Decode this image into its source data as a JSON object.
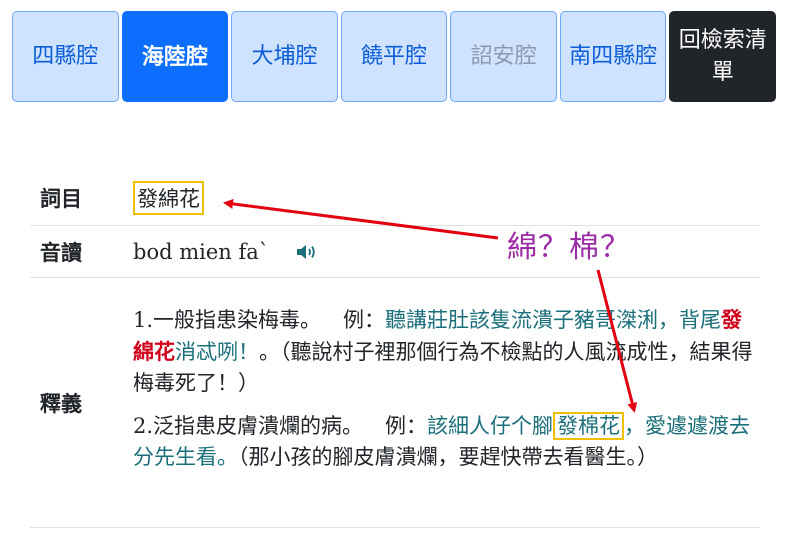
{
  "tabs": [
    {
      "label": "四縣腔",
      "state": "normal"
    },
    {
      "label": "海陸腔",
      "state": "active"
    },
    {
      "label": "大埔腔",
      "state": "normal"
    },
    {
      "label": "饒平腔",
      "state": "normal"
    },
    {
      "label": "詔安腔",
      "state": "disabled"
    },
    {
      "label": "南四縣腔",
      "state": "normal"
    },
    {
      "label": "回檢索清單",
      "state": "dark"
    }
  ],
  "entry": {
    "term_label": "詞目",
    "term": "發綿花",
    "pron_label": "音讀",
    "pron": "bod mien fa`",
    "pron_icon": "speaker-icon",
    "def_label": "釋義",
    "definitions": [
      {
        "num": "1.",
        "text": "一般指患染梅毒。",
        "ex_label": "例：",
        "ex_a": "聽講莊肚該隻流潰子豬哥滐",
        "ex_b": "浰，背尾",
        "ex_red": "發綿花",
        "ex_c": "消忒咧！",
        "ex_punct": "。",
        "gloss": "（聽說村子裡那個行為不檢點的人風流成性，結果得梅毒死了！）"
      },
      {
        "num": "2.",
        "text": "泛指患皮膚潰爛的病。",
        "ex_label": "例：",
        "ex_a": "該細人仔个腳",
        "ex_box": "發棉花",
        "ex_b": "，愛遽遽渡去分先生看。",
        "gloss": "（那小孩的腳皮膚潰爛，要趕快帶去看醫生。）"
      }
    ]
  },
  "annotation": {
    "text": "綿？棉？",
    "color": "#9b2ca6",
    "arrow_color": "#e3000f"
  },
  "colors": {
    "tab_bg": "#cfe2ff",
    "tab_active": "#0d6efd",
    "tab_dark": "#212529",
    "example": "#1a6f7a",
    "highlight_box": "#f0c000"
  }
}
